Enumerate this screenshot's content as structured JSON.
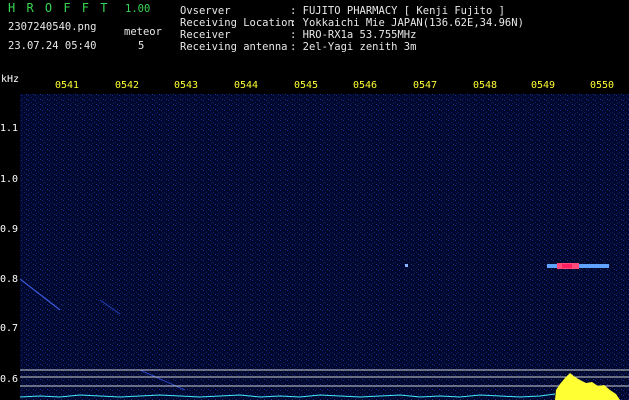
{
  "app": {
    "title_letters": "H R O F F T",
    "version": "1.00"
  },
  "file": {
    "name": "2307240540.png",
    "datetime": "23.07.24 05:40"
  },
  "counter": {
    "label": "meteor",
    "value": "5"
  },
  "info": [
    {
      "key": "Ovserver",
      "value": ": FUJITO PHARMACY [ Kenji Fujito ]"
    },
    {
      "key": "Receiving Location",
      "value": ": Yokkaichi Mie JAPAN(136.62E,34.96N)"
    },
    {
      "key": "Receiver",
      "value": ": HRO-RX1a 53.755MHz"
    },
    {
      "key": "Receiving antenna",
      "value": ": 2el-Yagi zenith 3m"
    }
  ],
  "axis": {
    "unit": "kHz",
    "time_ticks": [
      "0541",
      "0542",
      "0543",
      "0544",
      "0545",
      "0546",
      "0547",
      "0548",
      "0549",
      "0550"
    ],
    "freq_ticks": [
      "1.1",
      "1.0",
      "0.9",
      "0.8",
      "0.7",
      "0.6"
    ]
  },
  "colors": {
    "background": "#000000",
    "plot_bg": "#000a3a",
    "title_green": "#39d653",
    "tick_yellow": "#ffff33",
    "signal_cyan": "#44e8ff"
  }
}
